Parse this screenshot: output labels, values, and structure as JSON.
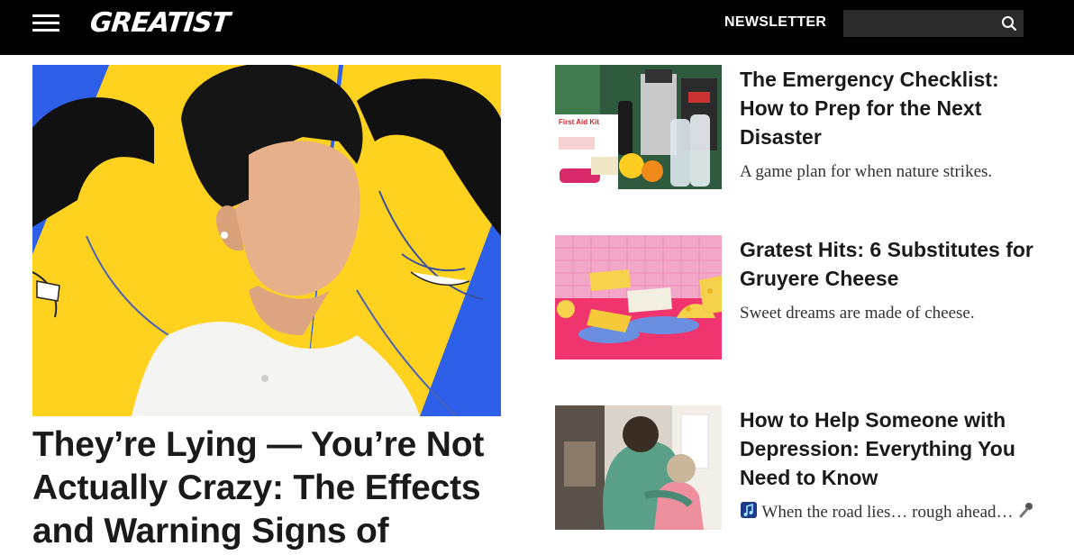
{
  "header": {
    "logo_text": "GREATIST",
    "newsletter_label": "NEWSLETTER",
    "search_placeholder": ""
  },
  "hero": {
    "title": "They’re Lying — You’re Not Actually Crazy: The Effects and Warning Signs of"
  },
  "cards": [
    {
      "title": "The Emergency Checklist: How to Prep for the Next Disaster",
      "dek": "A game plan for when nature strikes.",
      "image_label": "First Aid Kit"
    },
    {
      "title": "Gratest Hits: 6 Substitutes for Gruyere Cheese",
      "dek": "Sweet dreams are made of cheese."
    },
    {
      "title": "How to Help Someone with Depression: Everything You Need to Know",
      "dek_text": "When the road lies… rough ahead…"
    }
  ],
  "colors": {
    "topbar": "#000000",
    "hero_blue": "#2d5fe8",
    "hero_yellow": "#ffd21f",
    "cheese_pink": "#f2a6c8",
    "cheese_red": "#f0346e"
  }
}
